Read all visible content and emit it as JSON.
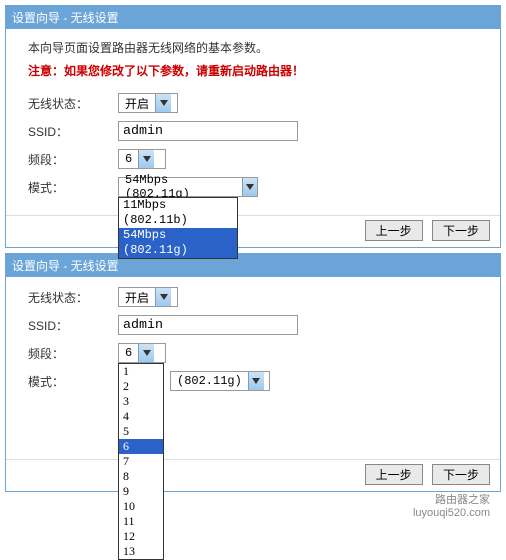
{
  "header_title": "设置向导 - 无线设置",
  "desc": "本向导页面设置路由器无线网络的基本参数。",
  "note": "注意：如果您修改了以下参数，请重新启动路由器！",
  "labels": {
    "status": "无线状态：",
    "ssid": "SSID：",
    "channel": "频段：",
    "mode": "模式："
  },
  "values": {
    "status": "开启",
    "ssid": "admin",
    "channel": "6",
    "mode": "54Mbps (802.11g)"
  },
  "mode_options": {
    "opt1": "11Mbps (802.11b)",
    "opt2": "54Mbps (802.11g)"
  },
  "channel_options": {
    "c1": "1",
    "c2": "2",
    "c3": "3",
    "c4": "4",
    "c5": "5",
    "c6": "6",
    "c7": "7",
    "c8": "8",
    "c9": "9",
    "c10": "10",
    "c11": "11",
    "c12": "12",
    "c13": "13"
  },
  "mode_extra": "(802.11g)",
  "buttons": {
    "prev": "上一步",
    "next": "下一步"
  },
  "watermark": {
    "line1": "路由器之家",
    "line2": "luyouqi520.com"
  }
}
